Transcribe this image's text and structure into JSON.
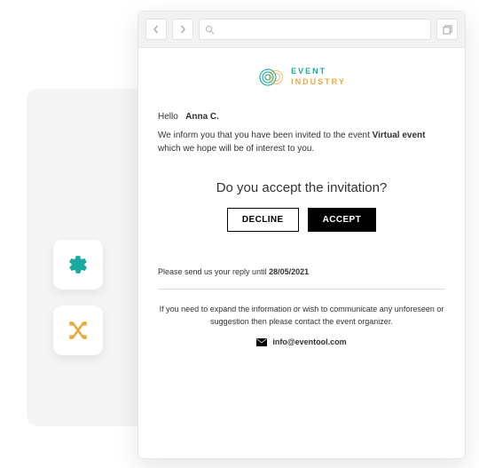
{
  "icons": {
    "gear": "gear-icon",
    "cross": "tools-cross-icon"
  },
  "logo": {
    "line1": "EVENT",
    "line2": "INDUSTRY"
  },
  "greeting": {
    "hello": "Hello",
    "name": "Anna C."
  },
  "body": {
    "part1": "We inform you that you have been invited to the event ",
    "event": "Virtual event",
    "part2": " which we hope will be of interest to you."
  },
  "question": "Do you accept the invitation?",
  "buttons": {
    "decline": "DECLINE",
    "accept": "ACCEPT"
  },
  "reply": {
    "text": "Please send us your reply until ",
    "date": "28/05/2021"
  },
  "footer": {
    "text": "If you need to expand the information or wish to communicate any unforeseen or suggestion then please contact the event organizer.",
    "email": "info@eventool.com"
  }
}
